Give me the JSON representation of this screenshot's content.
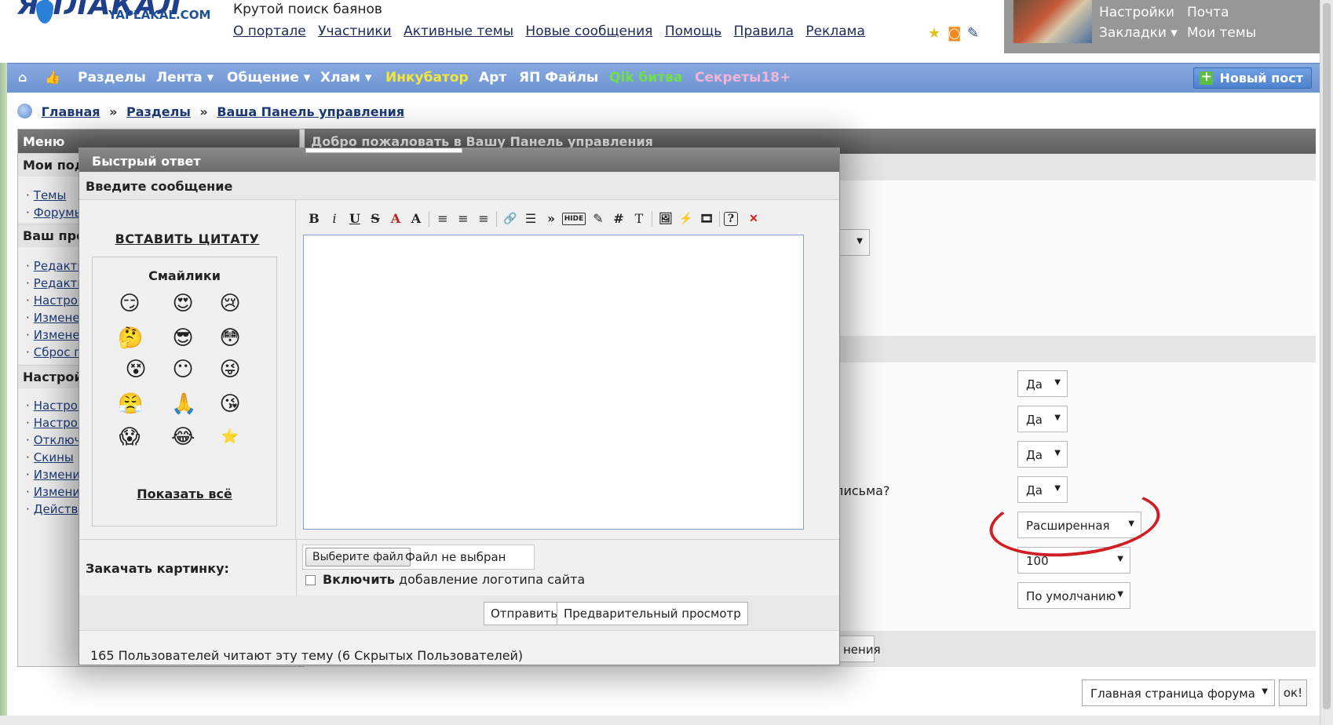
{
  "header": {
    "logo_mark": "ЯПЛАКАЛ",
    "logo_domain": "YAPLAKAL.COM",
    "tagline": "Крутой поиск баянов",
    "links": [
      "О портале",
      "Участники",
      "Активные темы",
      "Новые сообщения",
      "Помощь",
      "Правила",
      "Реклама"
    ],
    "user_links": {
      "settings": "Настройки",
      "mail": "Почта",
      "bookmarks": "Закладки ▾",
      "my_topics": "Мои темы"
    }
  },
  "nav": {
    "items": [
      {
        "label": "Разделы",
        "color": "#ffffff"
      },
      {
        "label": "Лента ▾",
        "color": "#ffffff"
      },
      {
        "label": "Общение ▾",
        "color": "#ffffff"
      },
      {
        "label": "Хлам ▾",
        "color": "#ffffff"
      },
      {
        "label": "Инкубатор",
        "color": "#f5e63a"
      },
      {
        "label": "Арт",
        "color": "#ffffff"
      },
      {
        "label": "ЯП Файлы",
        "color": "#ffffff"
      },
      {
        "label": "Qik битва",
        "color": "#6fe04a"
      },
      {
        "label": "Секреты18+",
        "color": "#f3b4d8"
      }
    ],
    "new_post": "Новый пост"
  },
  "breadcrumb": {
    "home": "Главная",
    "sections": "Разделы",
    "current": "Ваша Панель управления",
    "sep": "»"
  },
  "menu": {
    "title": "Меню",
    "sections": [
      {
        "title": "Мои под",
        "links": [
          "Темы",
          "Форумы"
        ]
      },
      {
        "title": "Ваш про",
        "links": [
          "Редакти",
          "Редакти",
          "Настрой",
          "Измене",
          "Измене",
          "Сброс г"
        ]
      },
      {
        "title": "Настрой",
        "links": [
          "Настрой",
          "Настрой",
          "Отключ",
          "Скины",
          "Измени",
          "Измени",
          "Действ"
        ]
      }
    ]
  },
  "main": {
    "heading": "Добро пожаловать в Вашу Панель управления",
    "letter_question": "письма?",
    "selects": [
      "Да",
      "Да",
      "Да",
      "Да",
      "Расширенная",
      "100",
      "По умолчанию"
    ],
    "save_button_fragment": "нения"
  },
  "jump": {
    "selected": "Главная страница форума",
    "ok": "ок!"
  },
  "modal": {
    "title": "Быстрый ответ",
    "subtitle": "Введите сообщение",
    "insert_quote": "ВСТАВИТЬ ЦИТАТУ",
    "smileys_title": "Смайлики",
    "smileys": [
      "😏",
      "😍",
      "😢",
      "🤔",
      "😎",
      "😳",
      "😵",
      "😶",
      "😜",
      "😤",
      "🙏",
      "😘",
      "😱",
      "😂",
      "⭐"
    ],
    "show_all": "Показать всё",
    "toolbar": [
      "B",
      "i",
      "U",
      "S",
      "A",
      "A",
      "≡",
      "≡",
      "≡",
      "🔗",
      "☰",
      "»",
      "HIDE",
      "✎",
      "#",
      "T",
      "🖼",
      "⚡",
      "🎞",
      "?",
      "✕"
    ],
    "message_value": "",
    "upload_label": "Закачать картинку:",
    "file_button": "Выберите файл",
    "file_status": "Файл не выбран",
    "logo_bold": "Включить",
    "logo_rest": "добавление логотипа сайта",
    "send": "Отправить",
    "preview": "Предварительный просмотр",
    "readers": "165 Пользователей читают эту тему (6 Скрытых Пользователей)"
  },
  "colors": {
    "nav_bg": "#7a9fdc",
    "panel_head": "#6b6b6b",
    "annotation": "#d01e25"
  }
}
